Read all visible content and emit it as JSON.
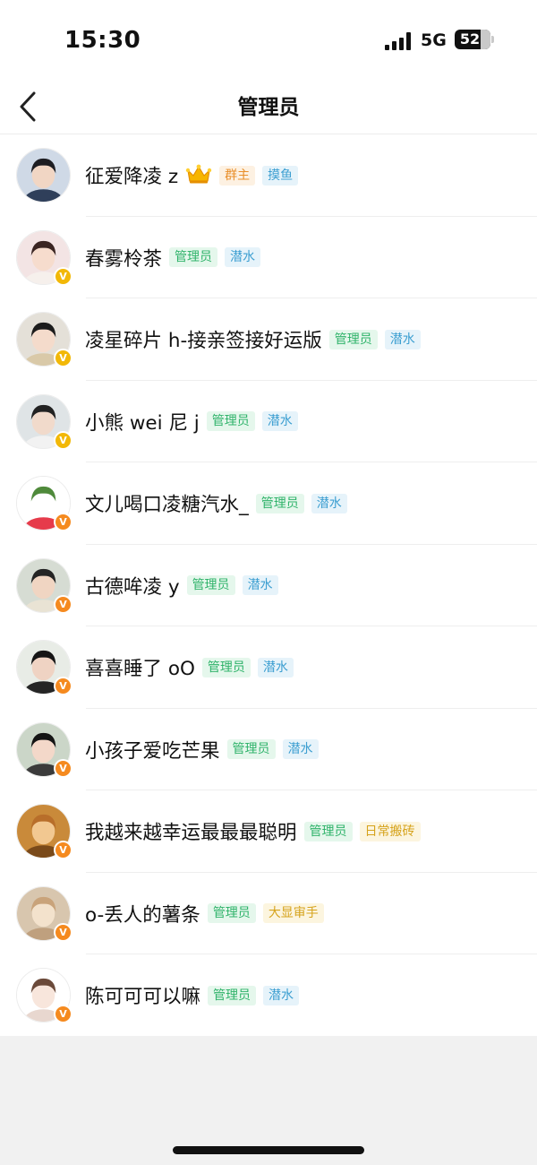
{
  "status_bar": {
    "time": "15:30",
    "network": "5G",
    "battery": "52",
    "signal_icon": "signal-bars-icon"
  },
  "header": {
    "title": "管理员",
    "back_icon": "chevron-left-icon"
  },
  "tag_colors": {
    "owner": {
      "fg": "#e98f2a",
      "bg": "#fdf1e2"
    },
    "admin": {
      "fg": "#2fb36a",
      "bg": "#e5f7ec"
    },
    "title_blue": {
      "fg": "#3d9fd1",
      "bg": "#e6f3fa"
    },
    "title_gold": {
      "fg": "#d6a31c",
      "bg": "#fcf5df"
    }
  },
  "members": [
    {
      "name": "征爱降凌 z",
      "role": "群主",
      "title": "摸鱼",
      "crown": true,
      "verified": false
    },
    {
      "name": "春雾柃茶",
      "role": "管理员",
      "title": "潜水",
      "verified_color": "#f2b807"
    },
    {
      "name": "凌星碎片 h-接亲签接好运版",
      "role": "管理员",
      "title": "潜水",
      "verified_color": "#f2b807"
    },
    {
      "name": "小熊 wei 尼 j",
      "role": "管理员",
      "title": "潜水",
      "verified_color": "#f2b807"
    },
    {
      "name": "文儿喝口凌糖汽水_",
      "role": "管理员",
      "title": "潜水",
      "verified_color": "#f58a1f"
    },
    {
      "name": "古德哞凌 y",
      "role": "管理员",
      "title": "潜水",
      "verified_color": "#f58a1f"
    },
    {
      "name": "喜喜睡了 oO",
      "role": "管理员",
      "title": "潜水",
      "verified_color": "#f58a1f"
    },
    {
      "name": "小孩子爱吃芒果",
      "role": "管理员",
      "title": "潜水",
      "verified_color": "#f58a1f"
    },
    {
      "name": "我越来越幸运最最最聪明",
      "role": "管理员",
      "title": "日常搬砖",
      "title_style": "gold",
      "verified_color": "#f58a1f"
    },
    {
      "name": "o-丢人的薯条",
      "role": "管理员",
      "title": "大显审手",
      "title_style": "gold",
      "verified_color": "#f58a1f"
    },
    {
      "name": "陈可可可以嘛",
      "role": "管理员",
      "title": "潜水",
      "verified_color": "#f58a1f"
    }
  ],
  "verified_glyph": "V"
}
